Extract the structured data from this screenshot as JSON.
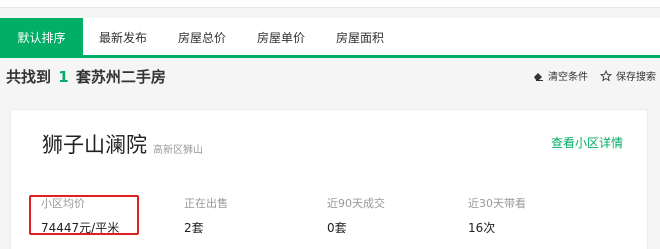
{
  "tabs": [
    {
      "label": "默认排序",
      "active": true
    },
    {
      "label": "最新发布",
      "active": false
    },
    {
      "label": "房屋总价",
      "active": false
    },
    {
      "label": "房屋单价",
      "active": false
    },
    {
      "label": "房屋面积",
      "active": false
    }
  ],
  "summary": {
    "prefix": "共找到",
    "count": "1",
    "suffix": "套苏州二手房"
  },
  "actions": {
    "clear": "清空条件",
    "save": "保存搜索"
  },
  "community": {
    "name": "狮子山澜院",
    "location": "高新区狮山",
    "detail_link": "查看小区详情"
  },
  "stats": [
    {
      "label": "小区均价",
      "value": "74447元/平米"
    },
    {
      "label": "正在出售",
      "value": "2套"
    },
    {
      "label": "近90天成交",
      "value": "0套"
    },
    {
      "label": "近30天带看",
      "value": "16次"
    }
  ],
  "colors": {
    "accent": "#00ae66",
    "highlight": "#e02020"
  }
}
